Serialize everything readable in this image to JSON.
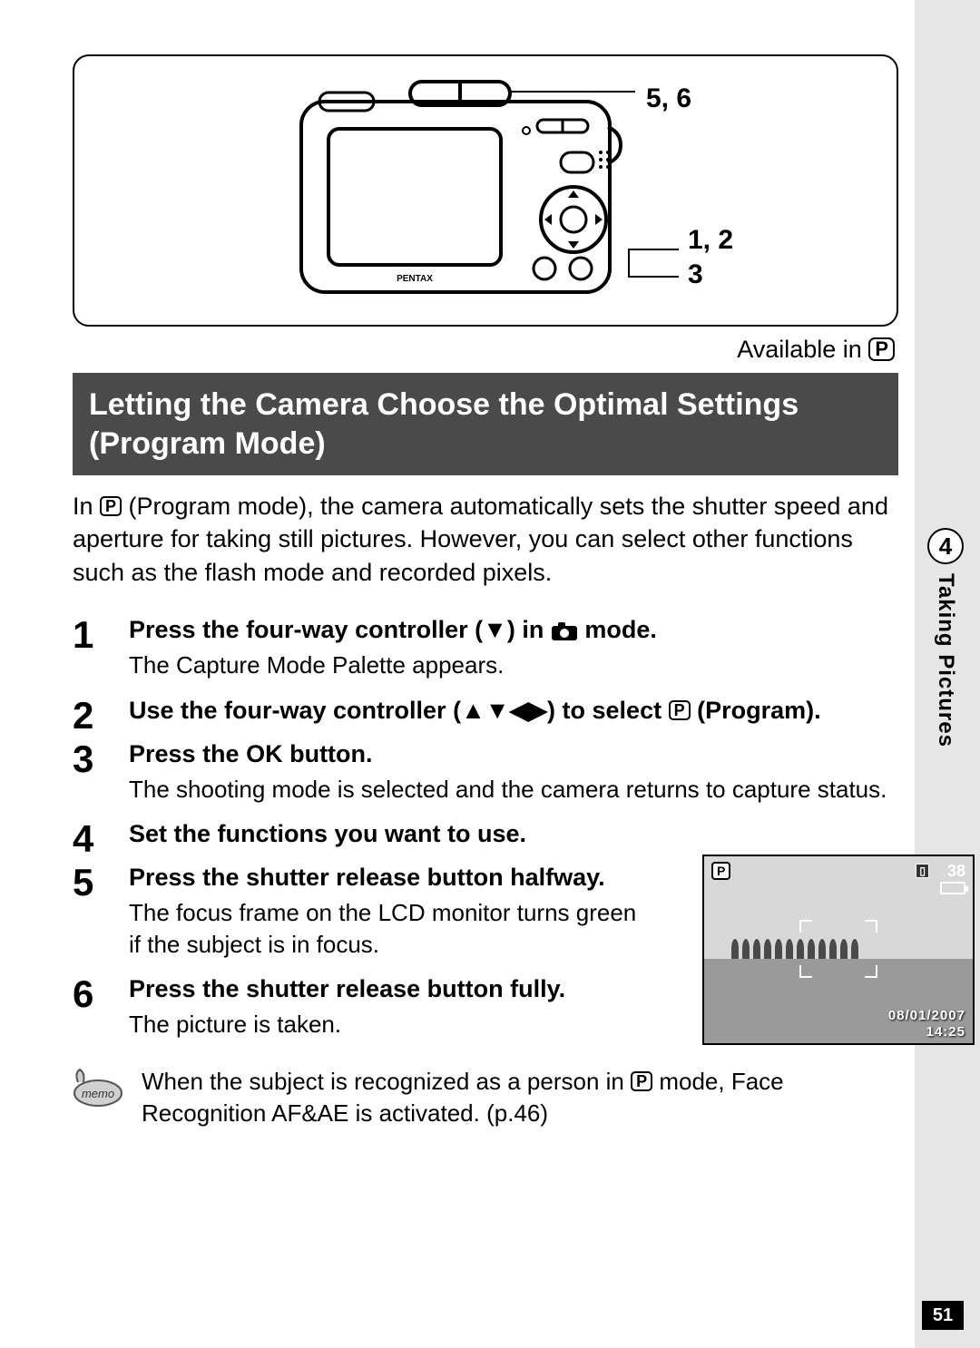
{
  "chapter": {
    "number": "4",
    "label": "Taking Pictures"
  },
  "page_number": "51",
  "diagram": {
    "callout_top": "5, 6",
    "callout_right": "1, 2\n3"
  },
  "available_in": "Available in ",
  "available_mode_letter": "P",
  "title": "Letting the Camera Choose the Optimal Settings (Program Mode)",
  "intro_pre": "In ",
  "intro_mode": "P",
  "intro_post": " (Program mode), the camera automatically sets the shutter speed and aperture for taking still pictures. However, you can select other functions such as the flash mode and recorded pixels.",
  "steps": {
    "s1": {
      "num": "1",
      "title_pre": "Press the four-way controller (",
      "title_mid": ") in ",
      "title_post": " mode.",
      "arrow": "▼",
      "desc": "The Capture Mode Palette appears."
    },
    "s2": {
      "num": "2",
      "title_pre": "Use the four-way controller (",
      "arrows": "▲▼◀▶",
      "title_mid": ") to select ",
      "mode": "P",
      "title_post": " (Program)."
    },
    "s3": {
      "num": "3",
      "title_pre": "Press the ",
      "ok": "OK",
      "title_post": " button.",
      "desc": "The shooting mode is selected and the camera returns to capture status."
    },
    "s4": {
      "num": "4",
      "title": "Set the functions you want to use."
    },
    "s5": {
      "num": "5",
      "title": "Press the shutter release button halfway.",
      "desc": "The focus frame on the LCD monitor turns green if the subject is in focus."
    },
    "s6": {
      "num": "6",
      "title": "Press the shutter release button fully.",
      "desc": "The picture is taken."
    }
  },
  "lcd": {
    "mode": "P",
    "count": "38",
    "date": "08/01/2007",
    "time": "14:25"
  },
  "memo": {
    "label": "memo",
    "text_pre": "When the subject is recognized as a person in ",
    "mode": "P",
    "text_post": " mode, Face Recognition AF&AE is activated. (p.46)"
  }
}
